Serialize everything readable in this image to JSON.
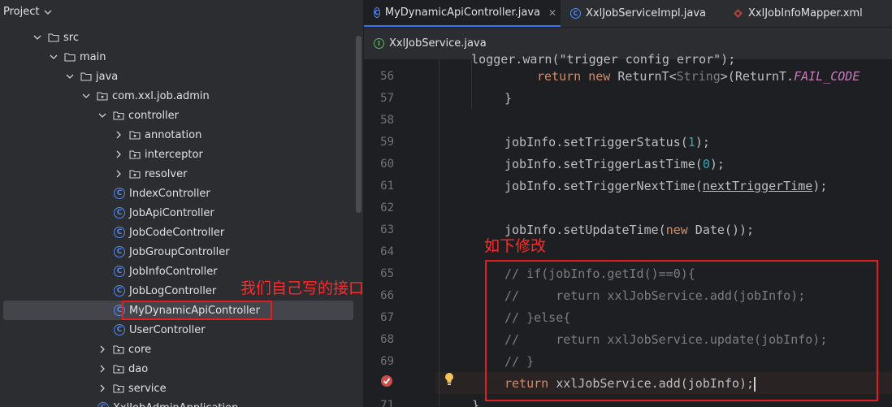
{
  "project_panel": {
    "title": "Project",
    "tree": [
      {
        "label": "src",
        "type": "folder",
        "expanded": true,
        "depth": 1
      },
      {
        "label": "main",
        "type": "folder",
        "expanded": true,
        "depth": 2
      },
      {
        "label": "java",
        "type": "folder",
        "expanded": true,
        "depth": 3
      },
      {
        "label": "com.xxl.job.admin",
        "type": "package",
        "expanded": true,
        "depth": 4
      },
      {
        "label": "controller",
        "type": "package",
        "expanded": true,
        "depth": 5
      },
      {
        "label": "annotation",
        "type": "package",
        "expanded": false,
        "depth": 6
      },
      {
        "label": "interceptor",
        "type": "package",
        "expanded": false,
        "depth": 6
      },
      {
        "label": "resolver",
        "type": "package",
        "expanded": false,
        "depth": 6
      },
      {
        "label": "IndexController",
        "type": "class",
        "depth": 6
      },
      {
        "label": "JobApiController",
        "type": "class",
        "depth": 6
      },
      {
        "label": "JobCodeController",
        "type": "class",
        "depth": 6
      },
      {
        "label": "JobGroupController",
        "type": "class",
        "depth": 6
      },
      {
        "label": "JobInfoController",
        "type": "class",
        "depth": 6
      },
      {
        "label": "JobLogController",
        "type": "class",
        "depth": 6
      },
      {
        "label": "MyDynamicApiController",
        "type": "class",
        "depth": 6,
        "selected": true
      },
      {
        "label": "UserController",
        "type": "class",
        "depth": 6
      },
      {
        "label": "core",
        "type": "package",
        "expanded": false,
        "depth": 5
      },
      {
        "label": "dao",
        "type": "package",
        "expanded": false,
        "depth": 5
      },
      {
        "label": "service",
        "type": "package",
        "expanded": false,
        "depth": 5
      },
      {
        "label": "XxlJobAdminApplication",
        "type": "class",
        "depth": 5
      }
    ],
    "annotation": "我们自己写的接口"
  },
  "editor": {
    "tabs": [
      {
        "label": "MyDynamicApiController.java",
        "icon": "class-icon",
        "active": true
      },
      {
        "label": "XxlJobServiceImpl.java",
        "icon": "class-icon",
        "active": false
      },
      {
        "label": "XxlJobInfoMapper.xml",
        "icon": "xml-icon",
        "active": false
      }
    ],
    "tabs_row2": [
      {
        "label": "XxlJobService.java",
        "icon": "interface-icon"
      }
    ],
    "line_numbers": [
      "56",
      "57",
      "58",
      "59",
      "60",
      "61",
      "62",
      "63",
      "64",
      "65",
      "66",
      "67",
      "68",
      "69",
      "",
      "71"
    ],
    "annotation": "如下修改",
    "code": {
      "l55": "    logger.warn(\"trigger config error\");",
      "l56_kw1": "return",
      "l56_kw2": "new",
      "l56_a": " ReturnT<",
      "l56_b": "String",
      "l56_c": ">(ReturnT.",
      "l56_d": "FAIL_CODE",
      "l57": "}",
      "l59_a": "jobInfo.setTriggerStatus(",
      "l59_n": "1",
      "l59_b": ");",
      "l60_a": "jobInfo.setTriggerLastTime(",
      "l60_n": "0",
      "l60_b": ");",
      "l61_a": "jobInfo.setTriggerNextTime(",
      "l61_u": "nextTriggerTime",
      "l61_b": ");",
      "l63_a": "jobInfo.setUpdateTime(",
      "l63_kw": "new",
      "l63_b": " Date());",
      "l65": "// if(jobInfo.getId()==0){",
      "l66": "//     return xxlJobService.add(jobInfo);",
      "l67": "// }else{",
      "l68": "//     return xxlJobService.update(jobInfo);",
      "l69": "// }",
      "l70_kw": "return",
      "l70_b": " xxlJobService.add(jobInfo);",
      "l71": "}"
    }
  },
  "colors": {
    "accent": "#3574f0",
    "annotation_red": "#ff2a2a"
  }
}
